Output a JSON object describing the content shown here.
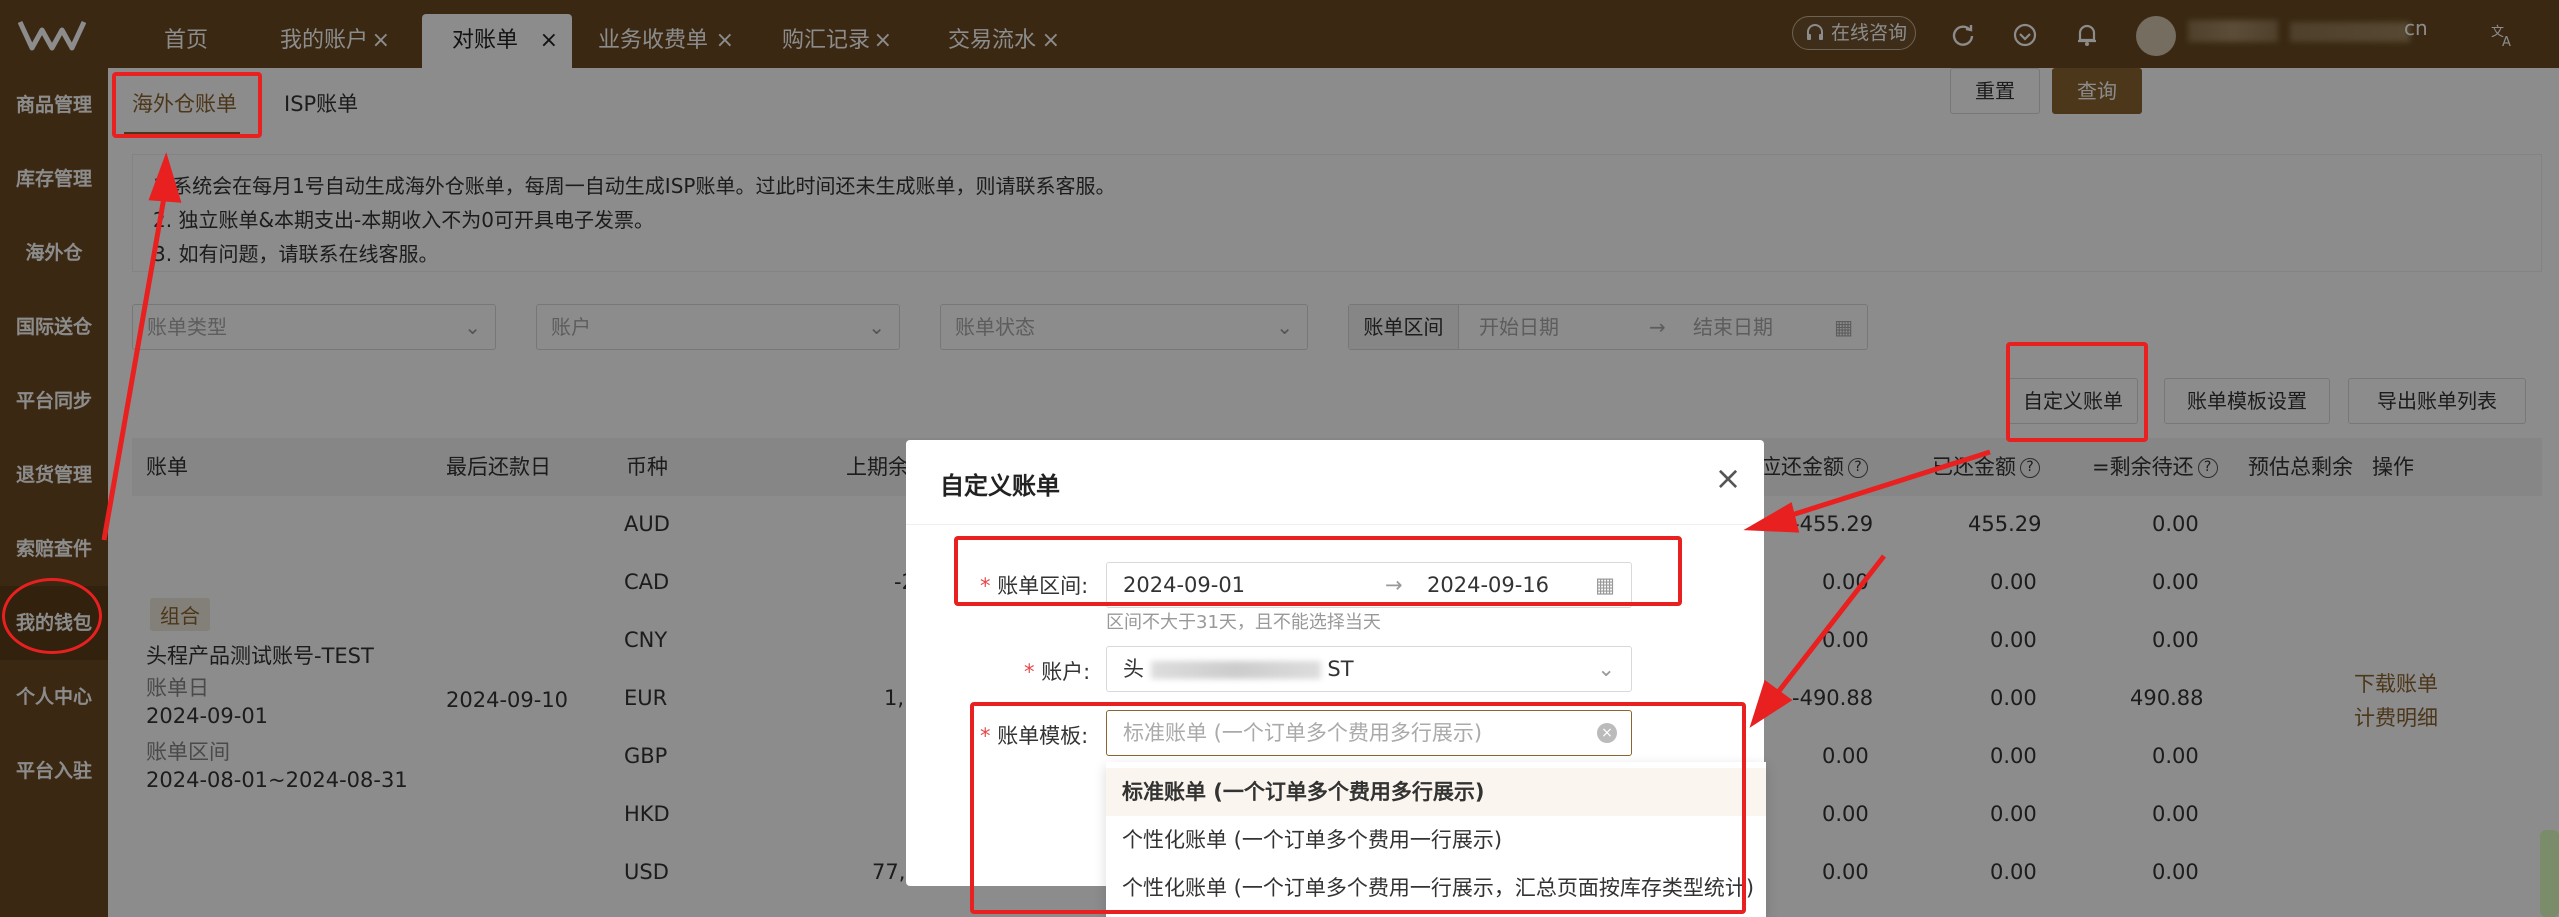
{
  "topbar": {
    "tabs": [
      {
        "label": "首页",
        "closable": false
      },
      {
        "label": "我的账户",
        "closable": true
      },
      {
        "label": "对账单",
        "closable": true,
        "active": true
      },
      {
        "label": "业务收费单",
        "closable": true
      },
      {
        "label": "购汇记录",
        "closable": true
      },
      {
        "label": "交易流水",
        "closable": true
      }
    ],
    "close_glyph": "×",
    "consult_label": "在线咨询",
    "user_tail": "cn",
    "icons": [
      "refresh-icon",
      "download-icon",
      "bell-icon",
      "translate-icon"
    ]
  },
  "sidebar": {
    "items": [
      {
        "label": "商品管理"
      },
      {
        "label": "库存管理"
      },
      {
        "label": "海外仓"
      },
      {
        "label": "国际送仓"
      },
      {
        "label": "平台同步"
      },
      {
        "label": "退货管理"
      },
      {
        "label": "索赔查件"
      },
      {
        "label": "我的钱包",
        "active": true
      },
      {
        "label": "个人中心"
      },
      {
        "label": "平台入驻"
      }
    ]
  },
  "subtabs": [
    {
      "label": "海外仓账单",
      "active": true
    },
    {
      "label": "ISP账单"
    }
  ],
  "notice": {
    "lines": [
      "1.系统会在每月1号自动生成海外仓账单，每周一自动生成ISP账单。过此时间还未生成账单，则请联系客服。",
      "2. 独立账单&本期支出-本期收入不为0可开具电子发票。",
      "3. 如有问题，请联系在线客服。"
    ]
  },
  "filters": {
    "bill_type_placeholder": "账单类型",
    "account_placeholder": "账户",
    "status_placeholder": "账单状态",
    "range_label": "账单区间",
    "start_placeholder": "开始日期",
    "range_arrow": "→",
    "end_placeholder": "结束日期",
    "reset_label": "重置",
    "query_label": "查询"
  },
  "actions": {
    "custom_bill": "自定义账单",
    "template_settings": "账单模板设置",
    "export_list": "导出账单列表"
  },
  "table": {
    "headers": {
      "bill": "账单",
      "due_date": "最后还款日",
      "currency": "币种",
      "prev_balance": "上期余",
      "payable": "应还金额",
      "paid": "已还金额",
      "remaining": "=剩余待还",
      "estimated": "预估总剩余",
      "ops": "操作"
    },
    "group": {
      "tag": "组合",
      "name": "头程产品测试账号-TEST",
      "bill_day_label": "账单日",
      "bill_day": "2024-09-01",
      "range_label": "账单区间",
      "range": "2024-08-01~2024-08-31",
      "due_date": "2024-09-10"
    },
    "rows": [
      {
        "currency": "AUD",
        "prev": "",
        "payable": "-455.29",
        "paid": "455.29",
        "remaining": "0.00"
      },
      {
        "currency": "CAD",
        "prev": "-2",
        "payable": "0.00",
        "paid": "0.00",
        "remaining": "0.00"
      },
      {
        "currency": "CNY",
        "prev": "",
        "payable": "0.00",
        "paid": "0.00",
        "remaining": "0.00"
      },
      {
        "currency": "EUR",
        "prev": "1,1",
        "payable": "-490.88",
        "paid": "0.00",
        "remaining": "490.88"
      },
      {
        "currency": "GBP",
        "prev": "",
        "payable": "0.00",
        "paid": "0.00",
        "remaining": "0.00"
      },
      {
        "currency": "HKD",
        "prev": "",
        "payable": "0.00",
        "paid": "0.00",
        "remaining": "0.00"
      },
      {
        "currency": "USD",
        "prev": "77,6",
        "payable": "0.00",
        "paid": "0.00",
        "remaining": "0.00"
      }
    ],
    "ops": {
      "download": "下载账单",
      "fee_detail": "计费明细"
    }
  },
  "modal": {
    "title": "自定义账单",
    "close_glyph": "×",
    "range_label": "账单区间:",
    "range_start": "2024-09-01",
    "range_arrow": "→",
    "range_end": "2024-09-16",
    "range_hint": "区间不大于31天，且不能选择当天",
    "account_label": "账户:",
    "account_prefix": "头",
    "account_suffix": "ST",
    "template_label": "账单模板:",
    "template_placeholder": "标准账单 (一个订单多个费用多行展示)",
    "required_mark": "*",
    "options": [
      {
        "label": "标准账单 (一个订单多个费用多行展示)",
        "selected": true
      },
      {
        "label": "个性化账单 (一个订单多个费用一行展示)"
      },
      {
        "label": "个性化账单 (一个订单多个费用一行展示，汇总页面按库存类型统计)"
      }
    ]
  },
  "annotation_color": "#e82020",
  "brand_color": "#6a4a21"
}
